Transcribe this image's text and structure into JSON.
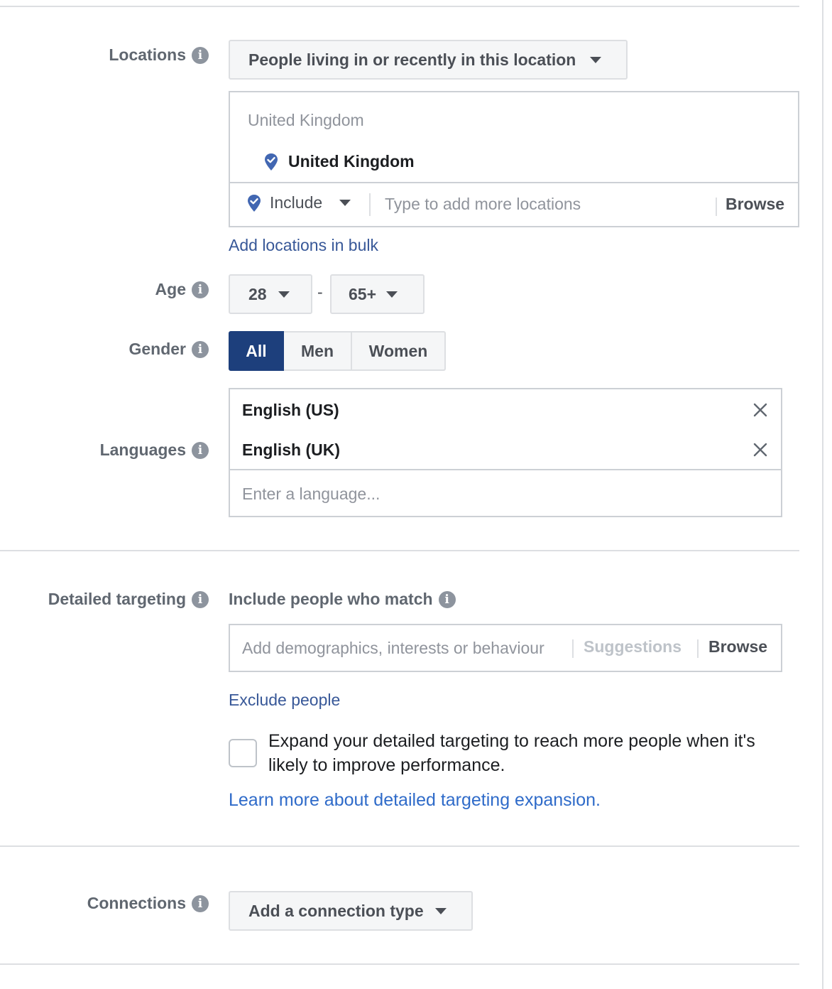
{
  "locations": {
    "label": "Locations",
    "mode_dropdown": "People living in or recently in this location",
    "group_header": "United Kingdom",
    "selected": "United Kingdom",
    "include_label": "Include",
    "search_placeholder": "Type to add more locations",
    "browse_label": "Browse",
    "bulk_link": "Add locations in bulk"
  },
  "age": {
    "label": "Age",
    "min": "28",
    "separator": "-",
    "max": "65+"
  },
  "gender": {
    "label": "Gender",
    "options": [
      "All",
      "Men",
      "Women"
    ],
    "selected": "All"
  },
  "languages": {
    "label": "Languages",
    "selected": [
      "English (US)",
      "English (UK)"
    ],
    "input_placeholder": "Enter a language..."
  },
  "detailed_targeting": {
    "label": "Detailed targeting",
    "include_heading": "Include people who match",
    "input_placeholder": "Add demographics, interests or behaviour",
    "suggestions_label": "Suggestions",
    "browse_label": "Browse",
    "exclude_link": "Exclude people",
    "expansion_checkbox_label": "Expand your detailed targeting to reach more people when it's likely to improve performance.",
    "expansion_checked": false,
    "learn_more_link": "Learn more about detailed targeting expansion."
  },
  "connections": {
    "label": "Connections",
    "dropdown": "Add a connection type"
  },
  "colors": {
    "selected_toggle": "#1d3f7c",
    "link": "#385898",
    "link_bright": "#2f6bc9",
    "pin": "#4267b2"
  }
}
